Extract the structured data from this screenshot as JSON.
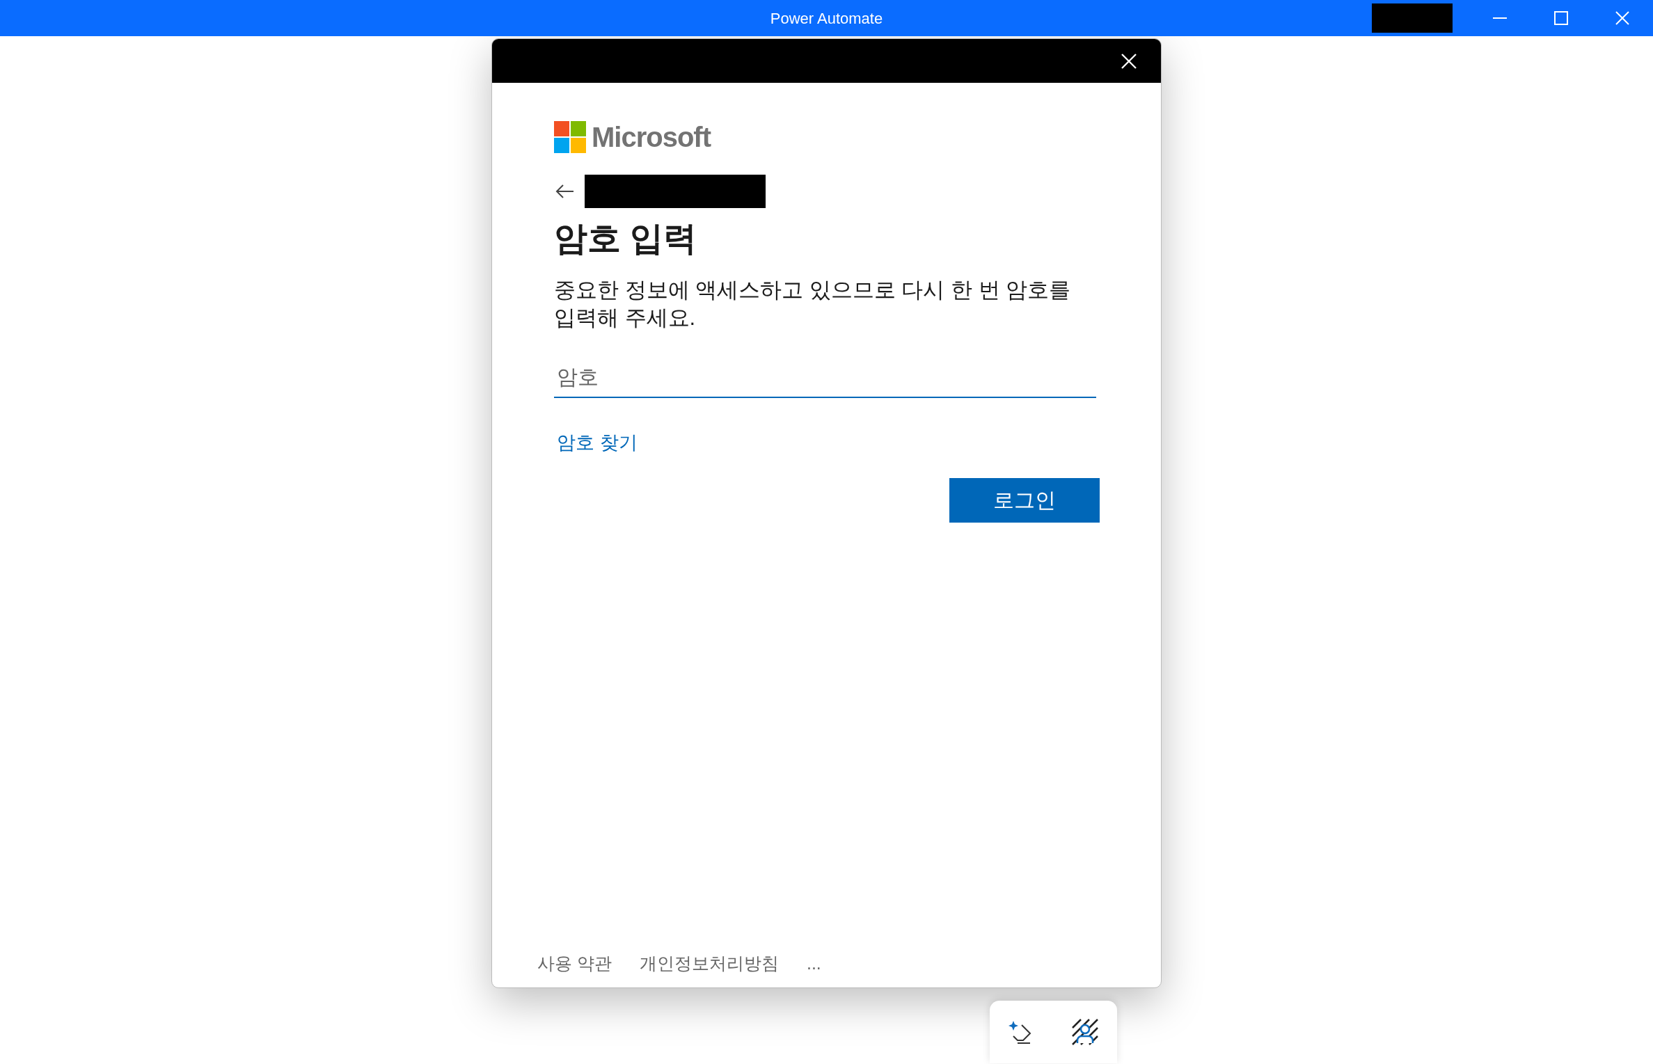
{
  "window": {
    "title": "Power Automate",
    "redacted_account": true
  },
  "dialog": {
    "redacted_email": true,
    "brand": "Microsoft",
    "heading": "암호 입력",
    "message": "중요한 정보에 액세스하고 있으므로 다시 한 번 암호를 입력해 주세요.",
    "password": {
      "placeholder": "암호"
    },
    "forgot_link": "암호 찾기",
    "submit": "로그인",
    "footer": [
      {
        "label": "사용 약관"
      },
      {
        "label": "개인정보처리방침"
      },
      {
        "label": "..."
      }
    ]
  }
}
